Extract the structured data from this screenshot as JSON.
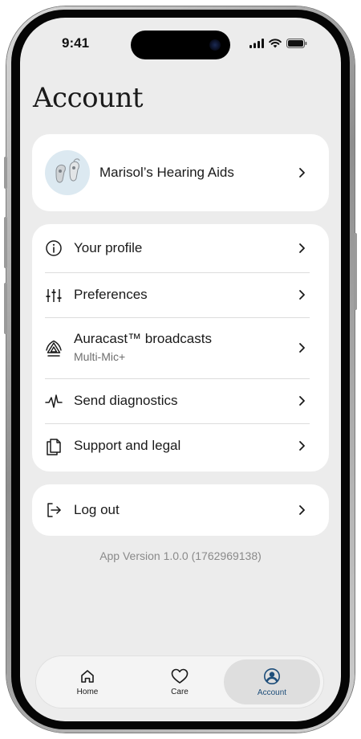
{
  "status_bar": {
    "time": "9:41"
  },
  "header": {
    "title": "Account"
  },
  "device": {
    "name": "Marisol’s Hearing Aids"
  },
  "menu": {
    "items": [
      {
        "label": "Your profile",
        "icon": "info-icon"
      },
      {
        "label": "Preferences",
        "icon": "sliders-icon"
      },
      {
        "label": "Auracast™ broadcasts",
        "sublabel": "Multi-Mic+",
        "icon": "broadcast-icon"
      },
      {
        "label": "Send diagnostics",
        "icon": "pulse-icon"
      },
      {
        "label": "Support and legal",
        "icon": "documents-icon"
      }
    ]
  },
  "logout": {
    "label": "Log out",
    "icon": "logout-icon"
  },
  "footer": {
    "version": "App Version 1.0.0 (1762969138)"
  },
  "tabbar": {
    "tabs": [
      {
        "label": "Home",
        "icon": "home-icon",
        "active": false
      },
      {
        "label": "Care",
        "icon": "heart-icon",
        "active": false
      },
      {
        "label": "Account",
        "icon": "account-icon",
        "active": true
      }
    ]
  },
  "colors": {
    "background": "#ececec",
    "card": "#ffffff",
    "active_tab_text": "#1e4e7a",
    "active_tab_bg": "#dedede"
  }
}
